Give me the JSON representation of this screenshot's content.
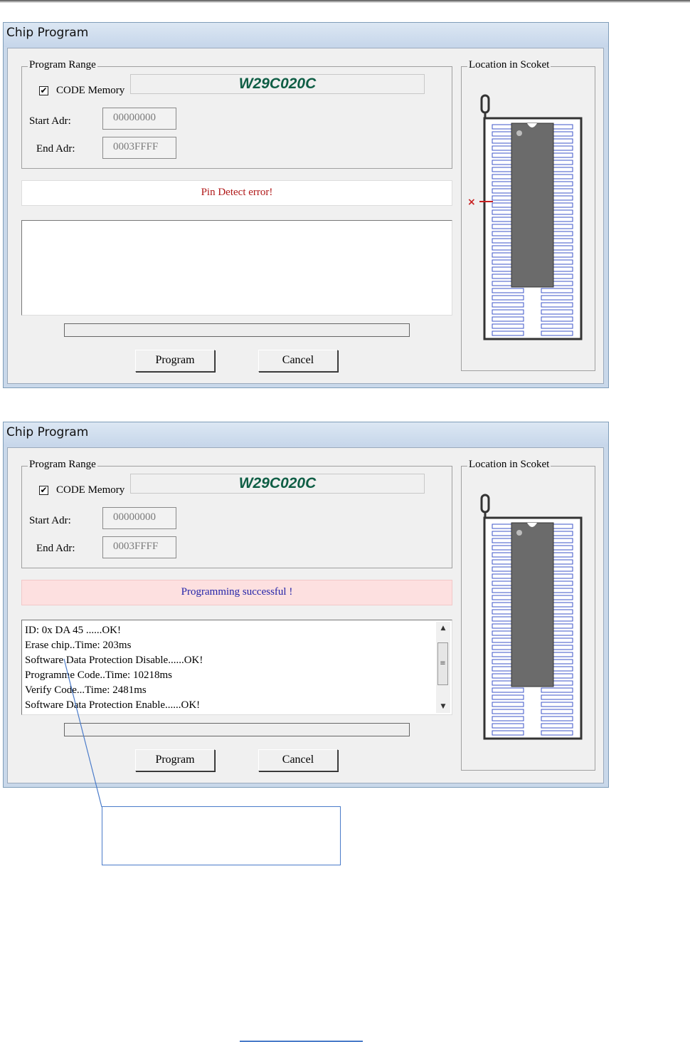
{
  "window_title": "Chip Program",
  "group_label": "Program Range",
  "chip_name": "W29C020C",
  "code_memory_label": "CODE Memory",
  "start_label": "Start Adr:",
  "end_label": "End Adr:",
  "start_value": "00000000",
  "end_value": "0003FFFF",
  "socket_label": "Location in Scoket",
  "program_button": "Program",
  "cancel_button": "Cancel",
  "dialog1": {
    "status_text": "Pin Detect error!",
    "status_color": "#b01818",
    "status_bg": "#ffffff",
    "pin_error_marker": "×"
  },
  "dialog2": {
    "status_text": "Programming successful !",
    "status_color": "#2323a8",
    "status_bg": "#fde0e0",
    "log": [
      "ID: 0x DA 45 ......OK!",
      "Erase chip..Time: 203ms",
      "Software Data Protection Disable......OK!",
      "Programme Code..Time: 10218ms",
      "Verify Code...Time: 2481ms",
      "Software Data Protection Enable......OK!"
    ]
  },
  "colors": {
    "chip_name": "#0f5e45",
    "socket_pin": "#3d55c8",
    "callout_border": "#4a7bc9"
  }
}
